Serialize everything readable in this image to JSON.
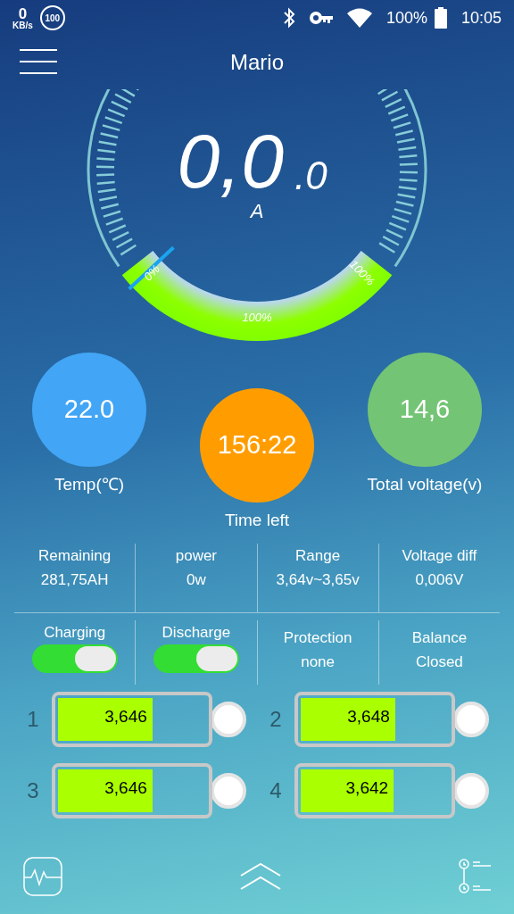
{
  "status_bar": {
    "net_speed": "0",
    "net_unit": "KB/s",
    "badge": "100",
    "battery": "100%",
    "time": "10:05"
  },
  "header": {
    "title": "Mario"
  },
  "gauge": {
    "value": "0,0",
    "decimal": ".0",
    "unit": "A",
    "scale_labels": [
      "0%",
      "100%",
      "100%"
    ]
  },
  "circles": [
    {
      "value": "22.0",
      "label": "Temp(℃)",
      "color": "#42a5f5"
    },
    {
      "value": "156:22",
      "label": "Time left",
      "color": "#ff9d00"
    },
    {
      "value": "14,6",
      "label": "Total voltage(v)",
      "color": "#74c476"
    }
  ],
  "stats": [
    {
      "label": "Remaining",
      "value": "281,75AH"
    },
    {
      "label": "power",
      "value": "0w"
    },
    {
      "label": "Range",
      "value": "3,64v~3,65v"
    },
    {
      "label": "Voltage diff",
      "value": "0,006V"
    }
  ],
  "controls": [
    {
      "kind": "switch",
      "label": "Charging",
      "on": true
    },
    {
      "kind": "switch",
      "label": "Discharge",
      "on": true
    },
    {
      "kind": "text",
      "label": "Protection",
      "value": "none"
    },
    {
      "kind": "text",
      "label": "Balance",
      "value": "Closed"
    }
  ],
  "cells": [
    {
      "number": "1",
      "voltage": "3,646",
      "level": 0.65
    },
    {
      "number": "2",
      "voltage": "3,648",
      "level": 0.65
    },
    {
      "number": "3",
      "voltage": "3,646",
      "level": 0.65
    },
    {
      "number": "4",
      "voltage": "3,642",
      "level": 0.64
    }
  ]
}
